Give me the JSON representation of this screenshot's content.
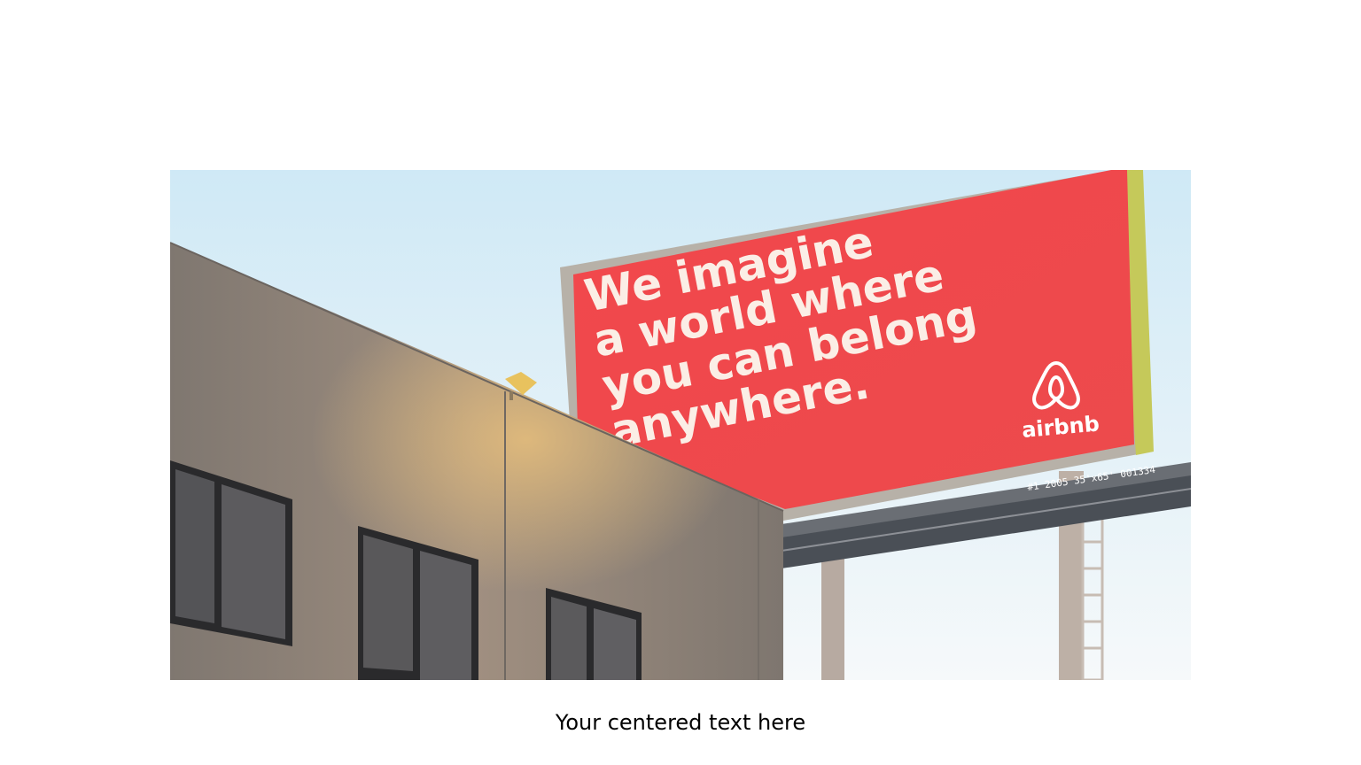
{
  "photo": {
    "billboard": {
      "lines": [
        "We imagine",
        "a world where",
        "you can belong",
        "anywhere."
      ],
      "brand": "airbnb",
      "panel_code": "#1 2005 35'x65' 001334"
    },
    "colors": {
      "sky_top": "#d4ecf7",
      "sky_bottom": "#f4f8fa",
      "billboard_red": "#f0494d",
      "building": "#8d847c"
    }
  },
  "caption": "Your centered text here"
}
